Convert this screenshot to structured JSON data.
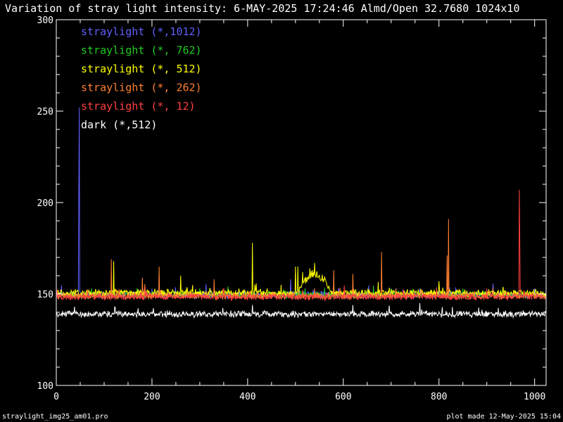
{
  "header": {
    "title": "Variation of stray light intensity:  6-MAY-2025 17:24:46   Almd/Open  32.7680 1024x10"
  },
  "footer": {
    "left": "straylight_img25_am01.pro",
    "right": "plot made 12-May-2025 15:04"
  },
  "colors": {
    "background": "#000000",
    "axes": "#ffffff"
  },
  "chart_data": {
    "type": "line",
    "title": "Variation of stray light intensity:  6-MAY-2025 17:24:46   Almd/Open  32.7680 1024x10",
    "xlim": [
      0,
      1024
    ],
    "ylim": [
      100,
      300
    ],
    "xticks": [
      0,
      200,
      400,
      600,
      800,
      1000
    ],
    "xtick_labels": [
      "0",
      "200",
      "400",
      "600",
      "800",
      "1000"
    ],
    "yticks": [
      100,
      150,
      200,
      250,
      300
    ],
    "ytick_labels": [
      "100",
      "150",
      "200",
      "250",
      "300"
    ],
    "legend_position": "top-left",
    "series": [
      {
        "name": "straylight (*,1012)",
        "color": "#6060ff",
        "baseline": 149.5,
        "noise": 1.5,
        "spikes": [
          [
            48,
            252
          ],
          [
            47,
            202
          ],
          [
            200,
            153
          ],
          [
            490,
            158
          ],
          [
            760,
            153
          ],
          [
            1000,
            153
          ]
        ]
      },
      {
        "name": "straylight (*, 762)",
        "color": "#22cc22",
        "baseline": 149.5,
        "noise": 1.5,
        "spikes": [
          [
            300,
            153
          ],
          [
            520,
            153
          ],
          [
            700,
            153
          ],
          [
            850,
            153
          ]
        ]
      },
      {
        "name": "straylight (*, 512)",
        "color": "#ffff00",
        "baseline": 150.5,
        "noise": 1.6,
        "spikes": [
          [
            120,
            168
          ],
          [
            410,
            178
          ],
          [
            260,
            160
          ],
          [
            500,
            165
          ],
          [
            515,
            162
          ],
          [
            505,
            165
          ],
          [
            540,
            167
          ],
          [
            530,
            164
          ],
          [
            470,
            155
          ],
          [
            800,
            157
          ]
        ],
        "bump": {
          "center": 540,
          "width": 35,
          "height": 12
        }
      },
      {
        "name": "straylight (*, 262)",
        "color": "#ff7f30",
        "baseline": 149,
        "noise": 1.5,
        "spikes": [
          [
            115,
            169
          ],
          [
            180,
            159
          ],
          [
            215,
            165
          ],
          [
            330,
            158
          ],
          [
            580,
            163
          ],
          [
            620,
            161
          ],
          [
            680,
            173
          ],
          [
            820,
            191
          ],
          [
            817,
            171
          ]
        ]
      },
      {
        "name": "straylight (*,  12)",
        "color": "#ff4040",
        "baseline": 148.5,
        "noise": 1.4,
        "spikes": [
          [
            968,
            207
          ],
          [
            969,
            179
          ],
          [
            350,
            153
          ],
          [
            900,
            153
          ]
        ]
      },
      {
        "name": "dark (*,512)",
        "color": "#ffffff",
        "baseline": 139,
        "noise": 1.4,
        "spikes": [
          [
            410,
            144
          ],
          [
            620,
            144
          ],
          [
            760,
            145
          ]
        ]
      }
    ]
  }
}
